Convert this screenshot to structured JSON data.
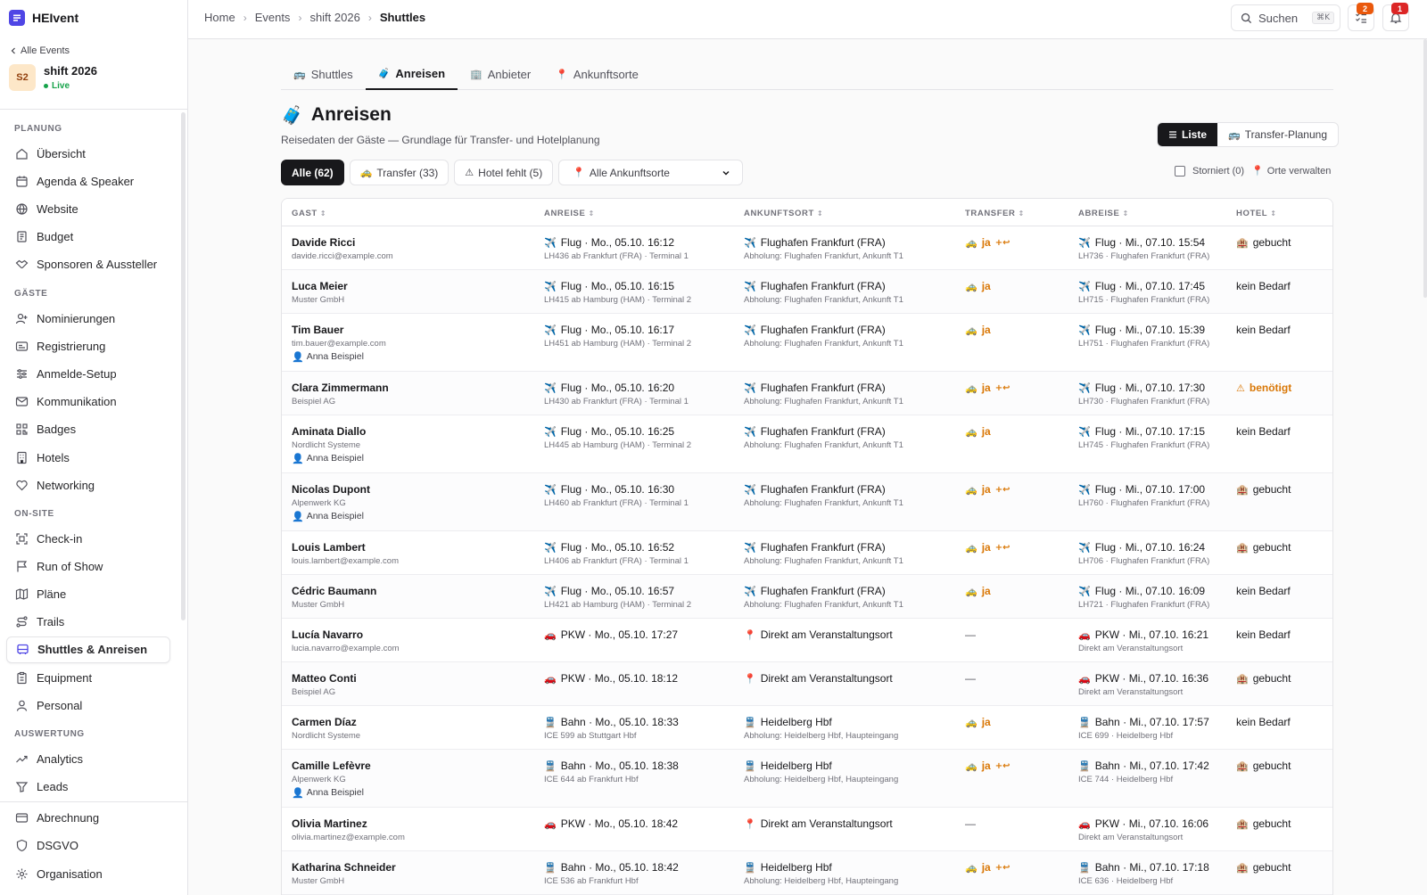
{
  "app": {
    "name": "HEIvent"
  },
  "event": {
    "back_label": "Alle Events",
    "name": "shift 2026",
    "initials": "S2",
    "status": "Live"
  },
  "sidebar": {
    "sections": [
      {
        "title": "PLANUNG",
        "items": [
          {
            "label": "Übersicht",
            "icon": "home-icon"
          },
          {
            "label": "Agenda & Speaker",
            "icon": "calendar-icon"
          },
          {
            "label": "Website",
            "icon": "globe-icon"
          },
          {
            "label": "Budget",
            "icon": "budget-icon"
          },
          {
            "label": "Sponsoren & Aussteller",
            "icon": "handshake-icon"
          }
        ]
      },
      {
        "title": "GÄSTE",
        "items": [
          {
            "label": "Nominierungen",
            "icon": "user-plus-icon"
          },
          {
            "label": "Registrierung",
            "icon": "id-card-icon"
          },
          {
            "label": "Anmelde-Setup",
            "icon": "sliders-icon"
          },
          {
            "label": "Kommunikation",
            "icon": "mail-icon"
          },
          {
            "label": "Badges",
            "icon": "qr-icon"
          },
          {
            "label": "Hotels",
            "icon": "building-icon"
          },
          {
            "label": "Networking",
            "icon": "heart-icon"
          }
        ]
      },
      {
        "title": "ON-SITE",
        "items": [
          {
            "label": "Check-in",
            "icon": "scan-icon"
          },
          {
            "label": "Run of Show",
            "icon": "flag-icon"
          },
          {
            "label": "Pläne",
            "icon": "map-icon"
          },
          {
            "label": "Trails",
            "icon": "route-icon"
          },
          {
            "label": "Shuttles & Anreisen",
            "icon": "bus-icon",
            "active": true
          },
          {
            "label": "Equipment",
            "icon": "clipboard-icon"
          },
          {
            "label": "Personal",
            "icon": "user-icon"
          }
        ]
      },
      {
        "title": "AUSWERTUNG",
        "items": [
          {
            "label": "Analytics",
            "icon": "trend-icon"
          },
          {
            "label": "Leads",
            "icon": "leads-icon"
          }
        ]
      }
    ],
    "bottom": [
      {
        "label": "Abrechnung",
        "icon": "card-icon"
      },
      {
        "label": "DSGVO",
        "icon": "shield-icon"
      },
      {
        "label": "Organisation",
        "icon": "gear-icon"
      }
    ]
  },
  "topbar": {
    "breadcrumb": [
      "Home",
      "Events",
      "shift 2026",
      "Shuttles"
    ],
    "search_label": "Suchen",
    "search_shortcut": "⌘K",
    "tasks_count": "2",
    "notifications_count": "1"
  },
  "tabs": [
    {
      "label": "Shuttles",
      "emoji": "🚌"
    },
    {
      "label": "Anreisen",
      "emoji": "🧳",
      "active": true
    },
    {
      "label": "Anbieter",
      "emoji": "🏢"
    },
    {
      "label": "Ankunftsorte",
      "emoji": "📍"
    }
  ],
  "page": {
    "emoji": "🧳",
    "title": "Anreisen",
    "subtitle": "Reisedaten der Gäste — Grundlage für Transfer- und Hotelplanung",
    "view_list": "Liste",
    "view_transfer": "Transfer-Planung"
  },
  "filters": {
    "all": "Alle (62)",
    "transfer": "Transfer (33)",
    "hotel_missing": "Hotel fehlt (5)",
    "location_select": "Alle Ankunftsorte",
    "cancelled": "Storniert (0)",
    "manage_locations": "Orte verwalten"
  },
  "table": {
    "columns": [
      "GAST",
      "ANREISE",
      "ANKUNFTSORT",
      "TRANSFER",
      "ABREISE",
      "HOTEL"
    ],
    "rows": [
      {
        "name": "Davide Ricci",
        "sub": "davide.ricci@example.com",
        "arr_mode": "flight",
        "arr": "Flug · Mo., 05.10. 16:12",
        "arr_sub": "LH436 ab Frankfurt (FRA) · Terminal 1",
        "loc_mode": "flight",
        "loc": "Flughafen Frankfurt (FRA)",
        "loc_sub": "Abholung: Flughafen Frankfurt, Ankunft T1",
        "transfer": "ja",
        "return": true,
        "dep_mode": "flight",
        "dep": "Flug · Mi., 07.10. 15:54",
        "dep_sub": "LH736 · Flughafen Frankfurt (FRA)",
        "hotel": "gebucht",
        "hotel_state": "booked"
      },
      {
        "name": "Luca Meier",
        "sub": "Muster GmbH",
        "arr_mode": "flight",
        "arr": "Flug · Mo., 05.10. 16:15",
        "arr_sub": "LH415 ab Hamburg (HAM) · Terminal 2",
        "loc_mode": "flight",
        "loc": "Flughafen Frankfurt (FRA)",
        "loc_sub": "Abholung: Flughafen Frankfurt, Ankunft T1",
        "transfer": "ja",
        "return": false,
        "dep_mode": "flight",
        "dep": "Flug · Mi., 07.10. 17:45",
        "dep_sub": "LH715 · Flughafen Frankfurt (FRA)",
        "hotel": "kein Bedarf",
        "hotel_state": "none"
      },
      {
        "name": "Tim Bauer",
        "sub": "tim.bauer@example.com",
        "contact": "Anna Beispiel",
        "arr_mode": "flight",
        "arr": "Flug · Mo., 05.10. 16:17",
        "arr_sub": "LH451 ab Hamburg (HAM) · Terminal 2",
        "loc_mode": "flight",
        "loc": "Flughafen Frankfurt (FRA)",
        "loc_sub": "Abholung: Flughafen Frankfurt, Ankunft T1",
        "transfer": "ja",
        "return": false,
        "dep_mode": "flight",
        "dep": "Flug · Mi., 07.10. 15:39",
        "dep_sub": "LH751 · Flughafen Frankfurt (FRA)",
        "hotel": "kein Bedarf",
        "hotel_state": "none"
      },
      {
        "name": "Clara Zimmermann",
        "sub": "Beispiel AG",
        "arr_mode": "flight",
        "arr": "Flug · Mo., 05.10. 16:20",
        "arr_sub": "LH430 ab Frankfurt (FRA) · Terminal 1",
        "loc_mode": "flight",
        "loc": "Flughafen Frankfurt (FRA)",
        "loc_sub": "Abholung: Flughafen Frankfurt, Ankunft T1",
        "transfer": "ja",
        "return": true,
        "dep_mode": "flight",
        "dep": "Flug · Mi., 07.10. 17:30",
        "dep_sub": "LH730 · Flughafen Frankfurt (FRA)",
        "hotel": "benötigt",
        "hotel_state": "needed"
      },
      {
        "name": "Aminata Diallo",
        "sub": "Nordlicht Systeme",
        "contact": "Anna Beispiel",
        "arr_mode": "flight",
        "arr": "Flug · Mo., 05.10. 16:25",
        "arr_sub": "LH445 ab Hamburg (HAM) · Terminal 2",
        "loc_mode": "flight",
        "loc": "Flughafen Frankfurt (FRA)",
        "loc_sub": "Abholung: Flughafen Frankfurt, Ankunft T1",
        "transfer": "ja",
        "return": false,
        "dep_mode": "flight",
        "dep": "Flug · Mi., 07.10. 17:15",
        "dep_sub": "LH745 · Flughafen Frankfurt (FRA)",
        "hotel": "kein Bedarf",
        "hotel_state": "none"
      },
      {
        "name": "Nicolas Dupont",
        "sub": "Alpenwerk KG",
        "contact": "Anna Beispiel",
        "arr_mode": "flight",
        "arr": "Flug · Mo., 05.10. 16:30",
        "arr_sub": "LH460 ab Frankfurt (FRA) · Terminal 1",
        "loc_mode": "flight",
        "loc": "Flughafen Frankfurt (FRA)",
        "loc_sub": "Abholung: Flughafen Frankfurt, Ankunft T1",
        "transfer": "ja",
        "return": true,
        "dep_mode": "flight",
        "dep": "Flug · Mi., 07.10. 17:00",
        "dep_sub": "LH760 · Flughafen Frankfurt (FRA)",
        "hotel": "gebucht",
        "hotel_state": "booked"
      },
      {
        "name": "Louis Lambert",
        "sub": "louis.lambert@example.com",
        "arr_mode": "flight",
        "arr": "Flug · Mo., 05.10. 16:52",
        "arr_sub": "LH406 ab Frankfurt (FRA) · Terminal 1",
        "loc_mode": "flight",
        "loc": "Flughafen Frankfurt (FRA)",
        "loc_sub": "Abholung: Flughafen Frankfurt, Ankunft T1",
        "transfer": "ja",
        "return": true,
        "dep_mode": "flight",
        "dep": "Flug · Mi., 07.10. 16:24",
        "dep_sub": "LH706 · Flughafen Frankfurt (FRA)",
        "hotel": "gebucht",
        "hotel_state": "booked"
      },
      {
        "name": "Cédric Baumann",
        "sub": "Muster GmbH",
        "arr_mode": "flight",
        "arr": "Flug · Mo., 05.10. 16:57",
        "arr_sub": "LH421 ab Hamburg (HAM) · Terminal 2",
        "loc_mode": "flight",
        "loc": "Flughafen Frankfurt (FRA)",
        "loc_sub": "Abholung: Flughafen Frankfurt, Ankunft T1",
        "transfer": "ja",
        "return": false,
        "dep_mode": "flight",
        "dep": "Flug · Mi., 07.10. 16:09",
        "dep_sub": "LH721 · Flughafen Frankfurt (FRA)",
        "hotel": "kein Bedarf",
        "hotel_state": "none"
      },
      {
        "name": "Lucía Navarro",
        "sub": "lucia.navarro@example.com",
        "arr_mode": "car",
        "arr": "PKW · Mo., 05.10. 17:27",
        "arr_sub": "",
        "loc_mode": "pin",
        "loc": "Direkt am Veranstaltungsort",
        "loc_sub": "",
        "transfer": "—",
        "return": false,
        "dep_mode": "car",
        "dep": "PKW · Mi., 07.10. 16:21",
        "dep_sub": "Direkt am Veranstaltungsort",
        "hotel": "kein Bedarf",
        "hotel_state": "none"
      },
      {
        "name": "Matteo Conti",
        "sub": "Beispiel AG",
        "arr_mode": "car",
        "arr": "PKW · Mo., 05.10. 18:12",
        "arr_sub": "",
        "loc_mode": "pin",
        "loc": "Direkt am Veranstaltungsort",
        "loc_sub": "",
        "transfer": "—",
        "return": false,
        "dep_mode": "car",
        "dep": "PKW · Mi., 07.10. 16:36",
        "dep_sub": "Direkt am Veranstaltungsort",
        "hotel": "gebucht",
        "hotel_state": "booked"
      },
      {
        "name": "Carmen Díaz",
        "sub": "Nordlicht Systeme",
        "arr_mode": "train",
        "arr": "Bahn · Mo., 05.10. 18:33",
        "arr_sub": "ICE 599 ab Stuttgart Hbf",
        "loc_mode": "train",
        "loc": "Heidelberg Hbf",
        "loc_sub": "Abholung: Heidelberg Hbf, Haupteingang",
        "transfer": "ja",
        "return": false,
        "dep_mode": "train",
        "dep": "Bahn · Mi., 07.10. 17:57",
        "dep_sub": "ICE 699 · Heidelberg Hbf",
        "hotel": "kein Bedarf",
        "hotel_state": "none"
      },
      {
        "name": "Camille Lefèvre",
        "sub": "Alpenwerk KG",
        "contact": "Anna Beispiel",
        "arr_mode": "train",
        "arr": "Bahn · Mo., 05.10. 18:38",
        "arr_sub": "ICE 644 ab Frankfurt Hbf",
        "loc_mode": "train",
        "loc": "Heidelberg Hbf",
        "loc_sub": "Abholung: Heidelberg Hbf, Haupteingang",
        "transfer": "ja",
        "return": true,
        "dep_mode": "train",
        "dep": "Bahn · Mi., 07.10. 17:42",
        "dep_sub": "ICE 744 · Heidelberg Hbf",
        "hotel": "gebucht",
        "hotel_state": "booked"
      },
      {
        "name": "Olivia Martinez",
        "sub": "olivia.martinez@example.com",
        "arr_mode": "car",
        "arr": "PKW · Mo., 05.10. 18:42",
        "arr_sub": "",
        "loc_mode": "pin",
        "loc": "Direkt am Veranstaltungsort",
        "loc_sub": "",
        "transfer": "—",
        "return": false,
        "dep_mode": "car",
        "dep": "PKW · Mi., 07.10. 16:06",
        "dep_sub": "Direkt am Veranstaltungsort",
        "hotel": "gebucht",
        "hotel_state": "booked"
      },
      {
        "name": "Katharina Schneider",
        "sub": "Muster GmbH",
        "arr_mode": "train",
        "arr": "Bahn · Mo., 05.10. 18:42",
        "arr_sub": "ICE 536 ab Frankfurt Hbf",
        "loc_mode": "train",
        "loc": "Heidelberg Hbf",
        "loc_sub": "Abholung: Heidelberg Hbf, Haupteingang",
        "transfer": "ja",
        "return": true,
        "dep_mode": "train",
        "dep": "Bahn · Mi., 07.10. 17:18",
        "dep_sub": "ICE 636 · Heidelberg Hbf",
        "hotel": "gebucht",
        "hotel_state": "booked"
      }
    ]
  },
  "colors": {
    "accent": "#4f46e5",
    "transfer": "#d97706",
    "live": "#16a34a",
    "warning": "#d97706"
  }
}
